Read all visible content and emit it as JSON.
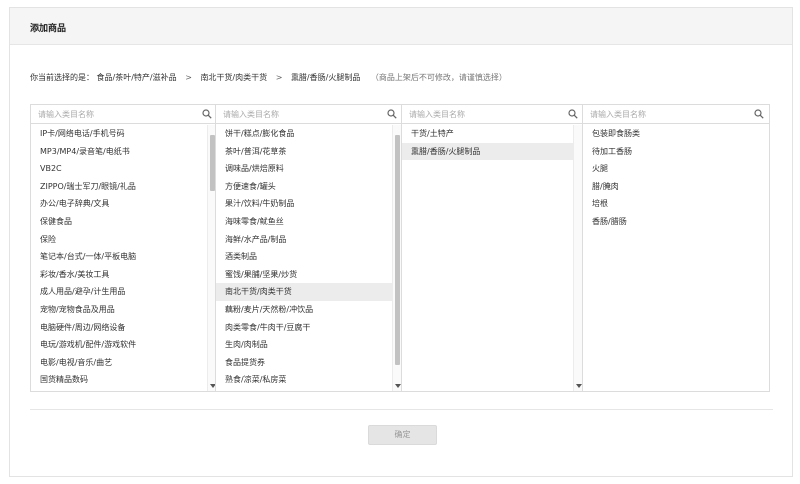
{
  "page": {
    "title": "添加商品"
  },
  "selection": {
    "label": "你当前选择的是：",
    "path": [
      "食品/茶叶/特产/滋补品",
      "南北干货/肉类干货",
      "熏腊/香肠/火腿制品"
    ],
    "separator": ">",
    "note": "（商品上架后不可修改，请谨慎选择）"
  },
  "search_placeholder": "请输入类目名称",
  "columns": [
    {
      "items": [
        "IP卡/网络电话/手机号码",
        "MP3/MP4/录音笔/电纸书",
        "VB2C",
        "ZIPPO/瑞士军刀/眼镜/礼品",
        "办公/电子辞典/文具",
        "保健食品",
        "保险",
        "笔记本/台式/一体/平板电脑",
        "彩妆/香水/美妆工具",
        "成人用品/避孕/计生用品",
        "宠物/宠物食品及用品",
        "电脑硬件/周边/网络设备",
        "电玩/游戏机/配件/游戏软件",
        "电影/电视/音乐/曲艺",
        "国货精品数码"
      ],
      "selected": null
    },
    {
      "items": [
        "饼干/糕点/膨化食品",
        "茶叶/普洱/花草茶",
        "调味品/烘焙原料",
        "方便速食/罐头",
        "果汁/饮料/牛奶制品",
        "海味零食/鱿鱼丝",
        "海鲜/水产品/制品",
        "酒类制品",
        "蜜饯/果脯/坚果/炒货",
        "南北干货/肉类干货",
        "藕粉/麦片/天然粉/冲饮品",
        "肉类零食/牛肉干/豆腐干",
        "生肉/肉制品",
        "食品提货券",
        "熟食/凉菜/私房菜"
      ],
      "selected": 9
    },
    {
      "items": [
        "干货/土特产",
        "熏腊/香肠/火腿制品"
      ],
      "selected": 1
    },
    {
      "items": [
        "包装即食肠类",
        "待加工香肠",
        "火腿",
        "腊/腌肉",
        "培根",
        "香肠/腊肠"
      ],
      "selected": null
    }
  ],
  "confirm_label": "确定"
}
